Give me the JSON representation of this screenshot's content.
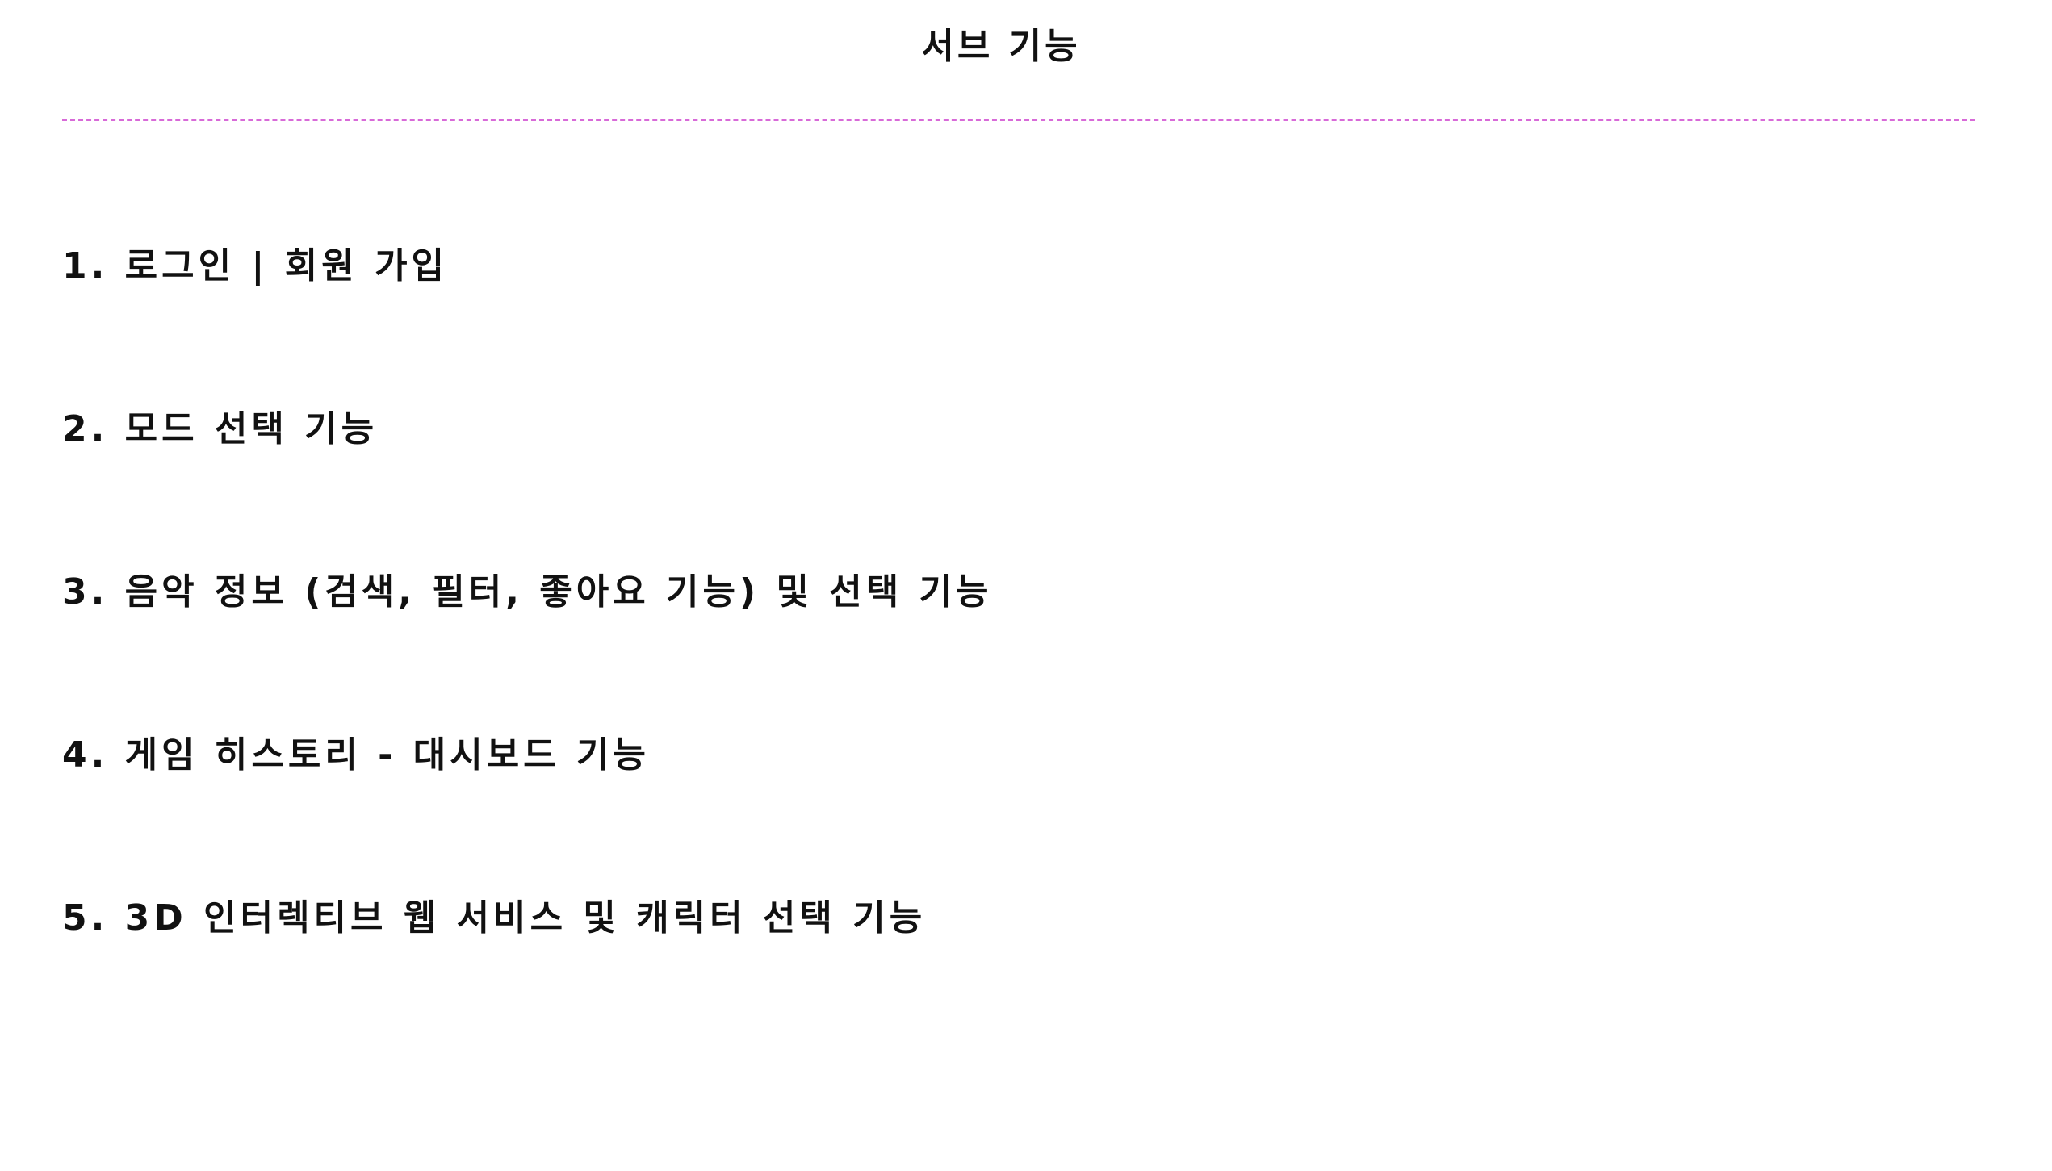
{
  "document": {
    "title": "서브 기능",
    "accent_color": "#d86ad8",
    "items": [
      "1. 로그인 | 회원 가입",
      "2. 모드 선택 기능",
      "3. 음악 정보 (검색, 필터, 좋아요 기능) 및 선택 기능",
      "4. 게임 히스토리 - 대시보드 기능",
      "5. 3D 인터렉티브 웹 서비스 및 캐릭터 선택 기능"
    ]
  }
}
